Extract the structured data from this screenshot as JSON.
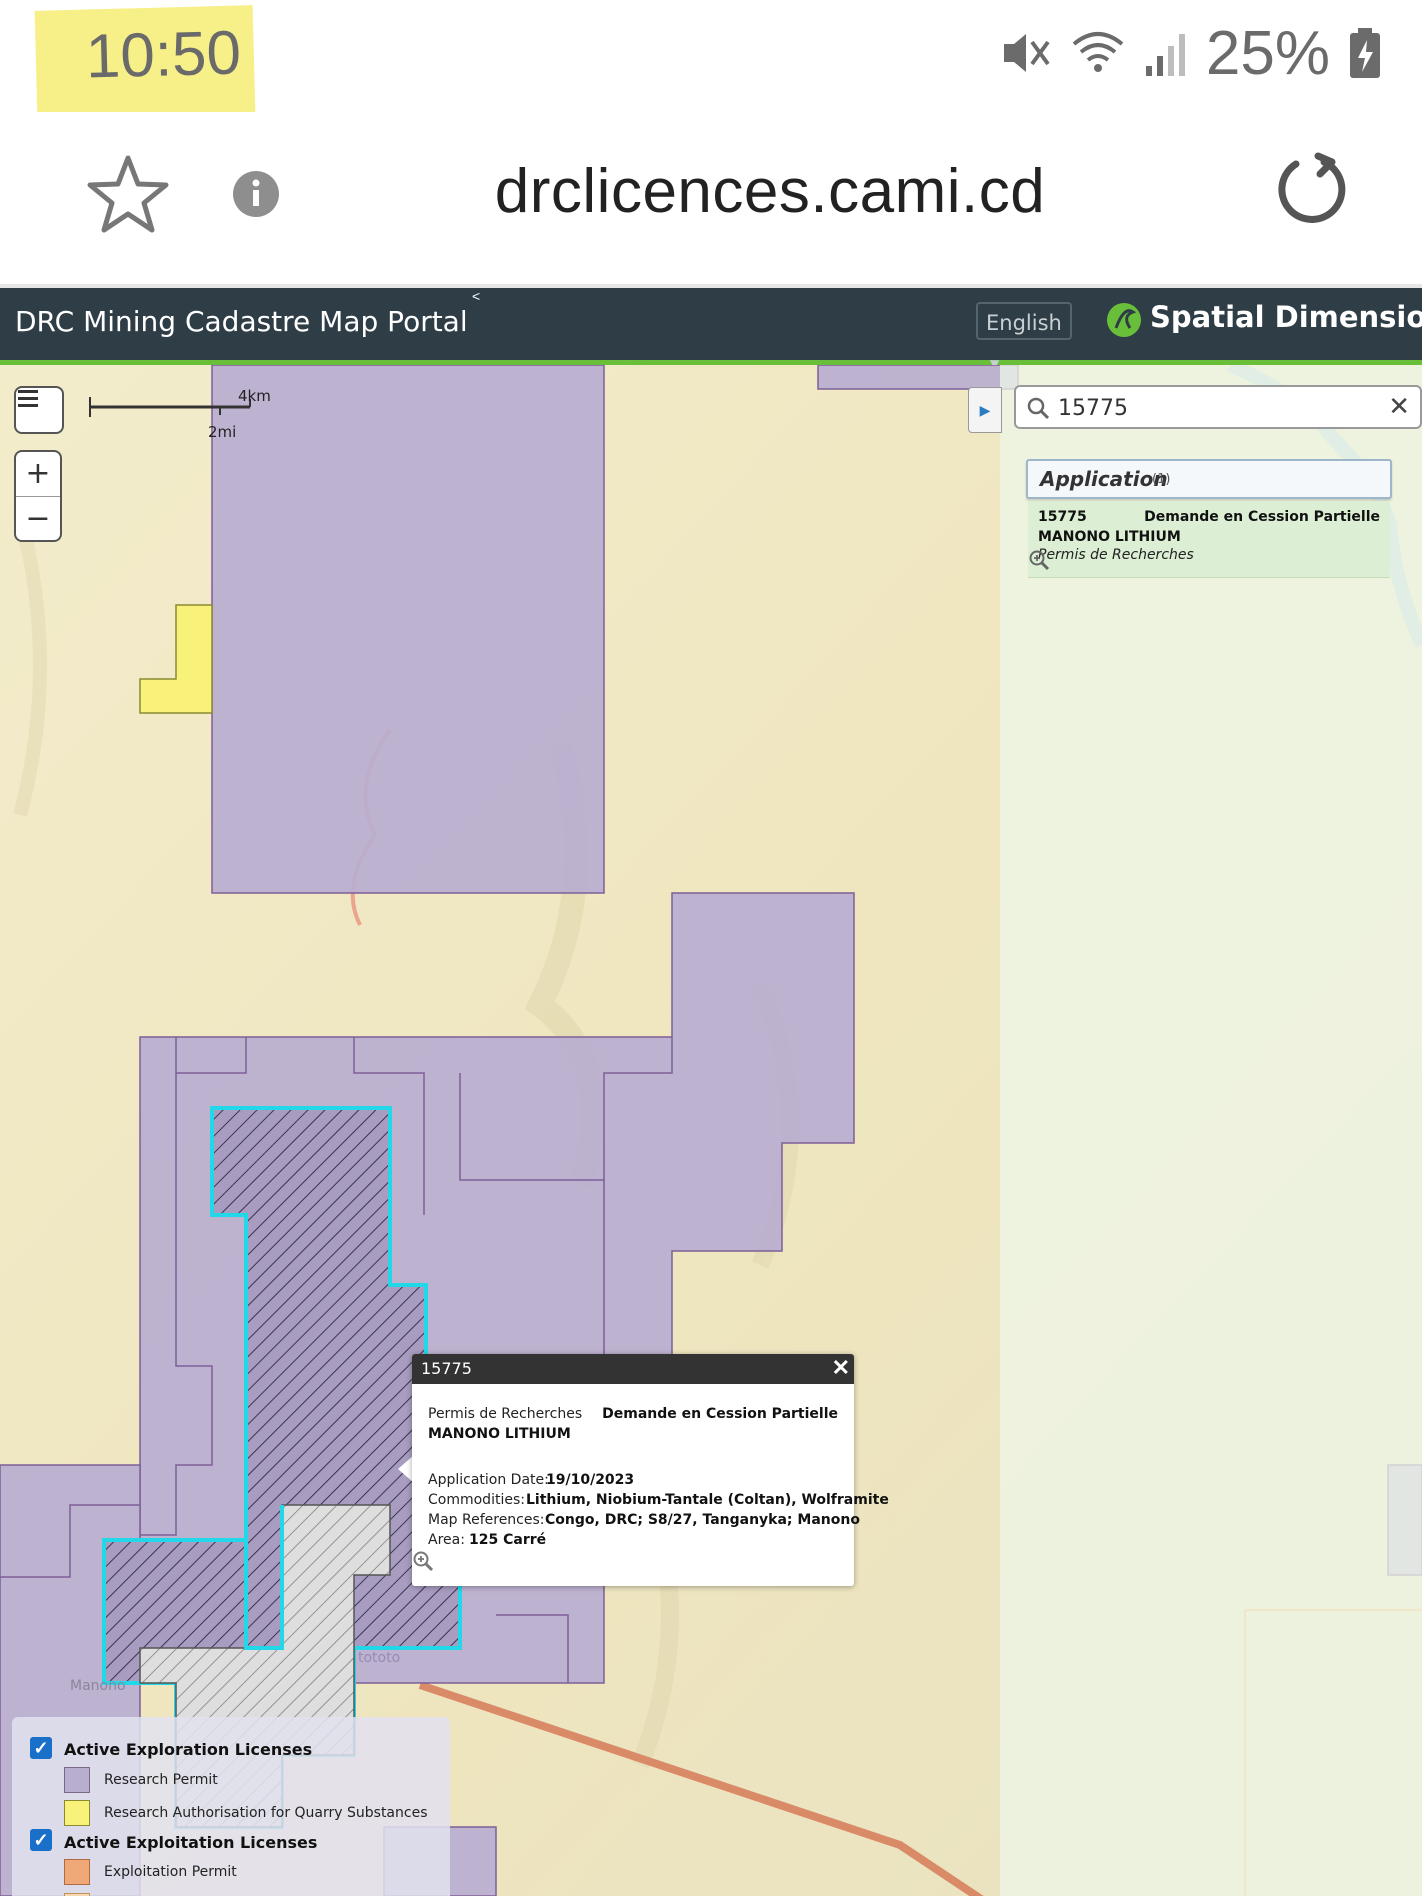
{
  "status_bar": {
    "time": "10:50",
    "battery": "25%"
  },
  "browser": {
    "url": "drclicences.cami.cd"
  },
  "app_bar": {
    "title": "DRC Mining Cadastre Map Portal",
    "collapse_caret": "<",
    "language": "English",
    "brand": "Spatial Dimension"
  },
  "map": {
    "scale_km": "4km",
    "scale_mi": "2mi",
    "place_labels": [
      "Manono",
      "tototo"
    ]
  },
  "search": {
    "value": "15775"
  },
  "results": {
    "header": "Application",
    "count": "(1)",
    "item": {
      "id": "15775",
      "type": "Demande en Cession Partielle",
      "company": "MANONO LITHIUM",
      "permit": "Permis de Recherches"
    }
  },
  "popup": {
    "title": "15775",
    "permit": "Permis de Recherches",
    "type": "Demande en Cession Partielle",
    "company": "MANONO LITHIUM",
    "rows": [
      {
        "label": "Application Date:",
        "value": "19/10/2023"
      },
      {
        "label": "Commodities:",
        "value": "Lithium, Niobium-Tantale (Coltan), Wolframite"
      },
      {
        "label": "Map References:",
        "value": "Congo, DRC; S8/27, Tanganyka; Manono"
      },
      {
        "label": "Area:",
        "value": "125 Carré"
      }
    ]
  },
  "legend": {
    "group1": "Active Exploration Licenses",
    "group1_items": [
      "Research Permit",
      "Research Authorisation for Quarry Substances"
    ],
    "group2": "Active Exploitation Licenses",
    "group2_items": [
      "Exploitation Permit"
    ]
  },
  "colors": {
    "research_permit": "#b8aed0",
    "quarry": "#f8f27a",
    "exploitation": "#f0a878",
    "selection": "#22d8e8",
    "app_bar": "#2f3e46",
    "accent_green": "#6abf3a"
  }
}
